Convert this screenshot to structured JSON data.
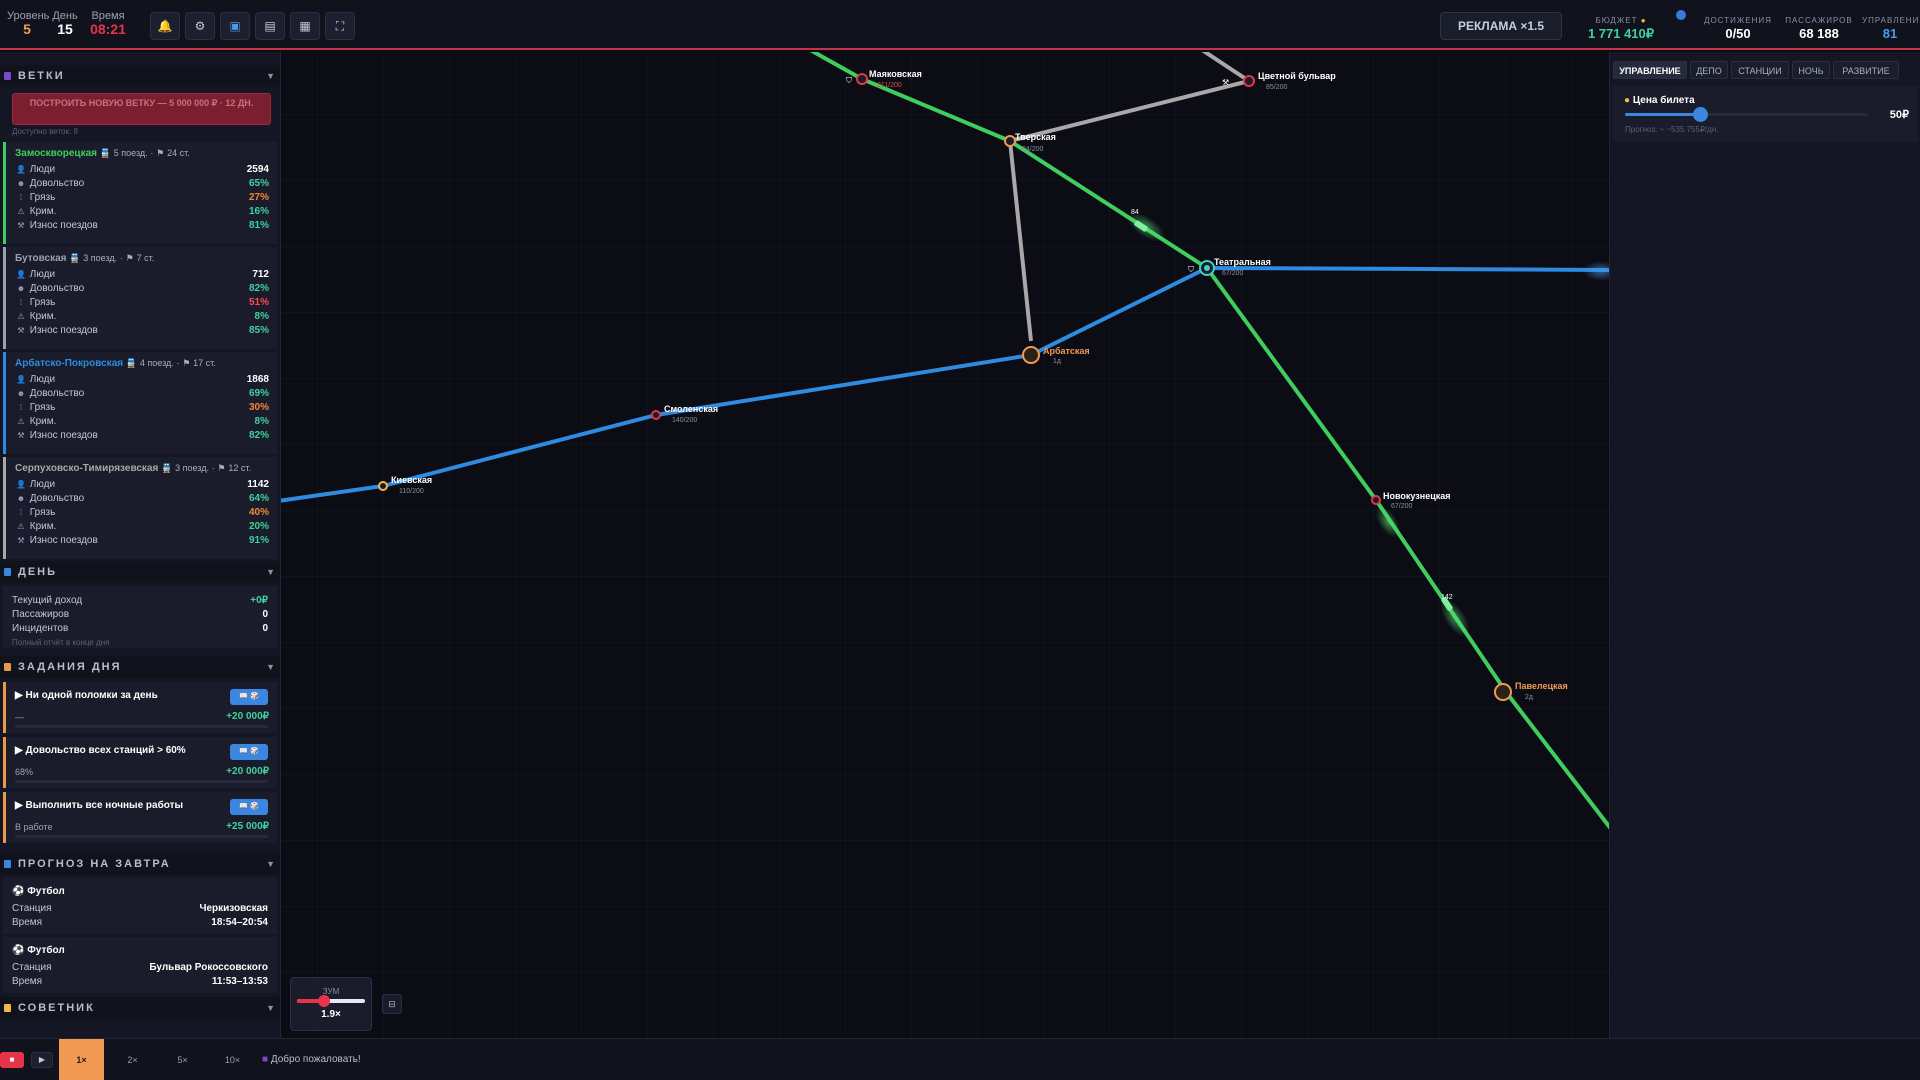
{
  "topbar": {
    "level_label": "Уровень",
    "level_value": "5",
    "day_label": "День",
    "day_value": "15",
    "time_label": "Время",
    "time_value": "08:21",
    "tools": [
      "bell-icon",
      "gear-icon",
      "screen-icon",
      "clipboard-icon",
      "chart-icon",
      "fullscreen-icon"
    ],
    "ad_label": "РЕКЛАМА ×1.5",
    "budget_label": "БЮДЖЕТ",
    "budget_value": "1 771 410₽",
    "achievements_label": "ДОСТИЖЕНИЯ",
    "achievements_value": "0/50",
    "passengers_label": "ПАССАЖИРОВ",
    "passengers_value": "68 188",
    "management_label": "УПРАВЛЕНИЕ",
    "management_value": "81"
  },
  "left": {
    "branches_title": "ВЕТКИ",
    "build_button": "ПОСТРОИТЬ НОВУЮ ВЕТКУ — 5 000 000 ₽ · 12 ДН.",
    "build_note": "Доступно веток: 8",
    "stat_labels": {
      "people": "Люди",
      "satisfaction": "Довольство",
      "dirt": "Грязь",
      "crime": "Крим.",
      "wear": "Износ поездов"
    },
    "branches": [
      {
        "name": "Замоскворецкая",
        "trains": "5 поезд.",
        "stations": "24 ст.",
        "color": "#3fce5e",
        "people": "2594",
        "satisfaction": "65%",
        "dirt": "27%",
        "crime": "16%",
        "wear": "81%",
        "dirt_color": "#f08a3a"
      },
      {
        "name": "Бутовская",
        "trains": "3 поезд.",
        "stations": "7 ст.",
        "color": "#9aa0b4",
        "people": "712",
        "satisfaction": "82%",
        "dirt": "51%",
        "crime": "8%",
        "wear": "85%",
        "dirt_color": "#ff4d4d"
      },
      {
        "name": "Арбатско-Покровская",
        "trains": "4 поезд.",
        "stations": "17 ст.",
        "color": "#2e8be0",
        "people": "1868",
        "satisfaction": "69%",
        "dirt": "30%",
        "crime": "8%",
        "wear": "82%",
        "dirt_color": "#f08a3a"
      },
      {
        "name": "Серпуховско-Тимирязевская",
        "trains": "3 поезд.",
        "stations": "12 ст.",
        "color": "#a8a8a8",
        "people": "1142",
        "satisfaction": "64%",
        "dirt": "40%",
        "crime": "20%",
        "wear": "91%",
        "dirt_color": "#f08a3a"
      }
    ],
    "day_title": "ДЕНЬ",
    "day": {
      "income_label": "Текущий доход",
      "income_value": "+0₽",
      "passengers_label": "Пассажиров",
      "passengers_value": "0",
      "incidents_label": "Инцидентов",
      "incidents_value": "0",
      "note": "Полный отчёт в конце дня"
    },
    "tasks_title": "ЗАДАНИЯ ДНЯ",
    "tasks": [
      {
        "title": "▶ Ни одной поломки за день",
        "progress": "—",
        "reward": "+20 000₽",
        "badge": "📖 🎲"
      },
      {
        "title": "▶ Довольство всех станций > 60%",
        "progress": "68%",
        "reward": "+20 000₽",
        "badge": "📖 🎲"
      },
      {
        "title": "▶ Выполнить все ночные работы",
        "progress": "В работе",
        "reward": "+25 000₽",
        "badge": "📖 🎲"
      }
    ],
    "forecast_title": "ПРОГНОЗ НА ЗАВТРА",
    "forecast": [
      {
        "title": "Футбол",
        "station_label": "Станция",
        "station": "Черкизовская",
        "time_label": "Время",
        "time": "18:54–20:54"
      },
      {
        "title": "Футбол",
        "station_label": "Станция",
        "station": "Бульвар Рокоссовского",
        "time_label": "Время",
        "time": "11:53–13:53"
      }
    ],
    "advisor_title": "СОВЕТНИК"
  },
  "map": {
    "stations": [
      {
        "name": "Маяковская",
        "sub": "211/200",
        "sub_color": "#e04a4a"
      },
      {
        "name": "Цветной бульвар",
        "sub": "85/200",
        "sub_color": "#8a90a4"
      },
      {
        "name": "Тверская",
        "sub": "94/200",
        "sub_color": "#8a90a4"
      },
      {
        "name": "Театральная",
        "sub": "67/200",
        "sub_color": "#8a90a4"
      },
      {
        "name": "Арбатская",
        "sub": "1д",
        "sub_color": "#8a90a4"
      },
      {
        "name": "Смоленская",
        "sub": "140/200",
        "sub_color": "#8a90a4"
      },
      {
        "name": "Киевская",
        "sub": "110/200",
        "sub_color": "#8a90a4"
      },
      {
        "name": "Новокузнецкая",
        "sub": "67/200",
        "sub_color": "#8a90a4"
      },
      {
        "name": "Павелецкая",
        "sub": "2д",
        "sub_color": "#8a90a4"
      }
    ],
    "train_labels": [
      "84",
      "142"
    ],
    "zoom_label": "ЗУМ",
    "zoom_value": "1.9×"
  },
  "right": {
    "tabs": [
      "УПРАВЛЕНИЕ",
      "ДЕПО",
      "СТАНЦИИ",
      "НОЧЬ",
      "РАЗВИТИЕ"
    ],
    "ticket_label": "Цена билета",
    "ticket_value": "50₽",
    "ticket_forecast": "Прогноз: ~ ~535 755₽/дн."
  },
  "bottom": {
    "speeds": [
      "1×",
      "2×",
      "5×",
      "10×"
    ],
    "message": "Добро пожаловать!"
  },
  "colors": {
    "green_line": "#3fce5e",
    "blue_line": "#2e8be0",
    "gray_line": "#a8a8a8",
    "accent": "#f09a55",
    "danger": "#e8344a",
    "positive": "#3fd1a0"
  }
}
